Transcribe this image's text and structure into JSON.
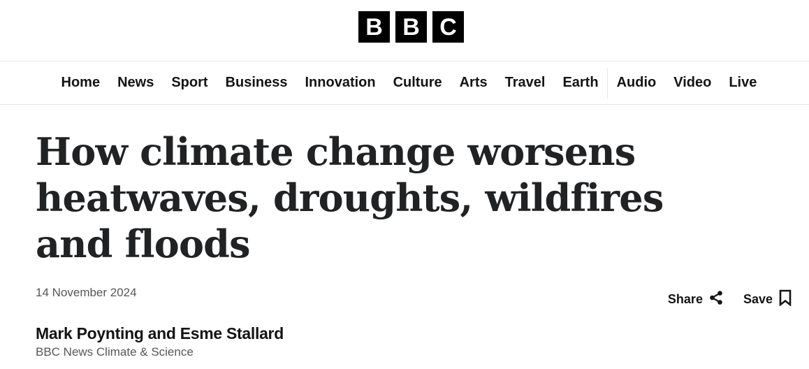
{
  "brand": {
    "letters": [
      "B",
      "B",
      "C"
    ]
  },
  "nav": {
    "items": [
      "Home",
      "News",
      "Sport",
      "Business",
      "Innovation",
      "Culture",
      "Arts",
      "Travel",
      "Earth"
    ],
    "secondary_items": [
      "Audio",
      "Video",
      "Live"
    ]
  },
  "article": {
    "headline": "How climate change worsens heatwaves, droughts, wildfires and floods",
    "date": "14 November 2024",
    "author": "Mark Poynting and Esme Stallard",
    "author_role": "BBC News Climate & Science"
  },
  "actions": {
    "share_label": "Share",
    "share_icon": "share-icon",
    "save_label": "Save",
    "save_icon": "bookmark-icon"
  }
}
